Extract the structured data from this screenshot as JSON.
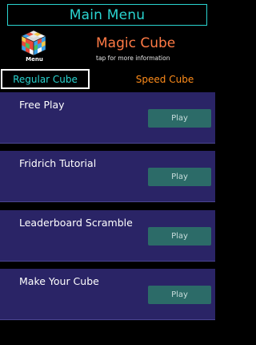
{
  "header": {
    "title": "Main Menu"
  },
  "brand": {
    "icon": "rubiks-cube-icon",
    "menu_caption": "Menu",
    "app_title": "Magic Cube",
    "subtitle": "tap for more information"
  },
  "tabs": [
    {
      "label": "Regular Cube",
      "selected": true
    },
    {
      "label": "Speed Cube",
      "selected": false
    }
  ],
  "cards": [
    {
      "title": "Free Play",
      "button": "Play"
    },
    {
      "title": "Fridrich Tutorial",
      "button": "Play"
    },
    {
      "title": "Leaderboard Scramble",
      "button": "Play"
    },
    {
      "title": "Make Your Cube",
      "button": "Play"
    }
  ],
  "colors": {
    "accent_cyan": "#2ad4d0",
    "accent_orange": "#ff7a45",
    "card_bg": "#2a2466",
    "button_bg": "#2c6b68"
  }
}
